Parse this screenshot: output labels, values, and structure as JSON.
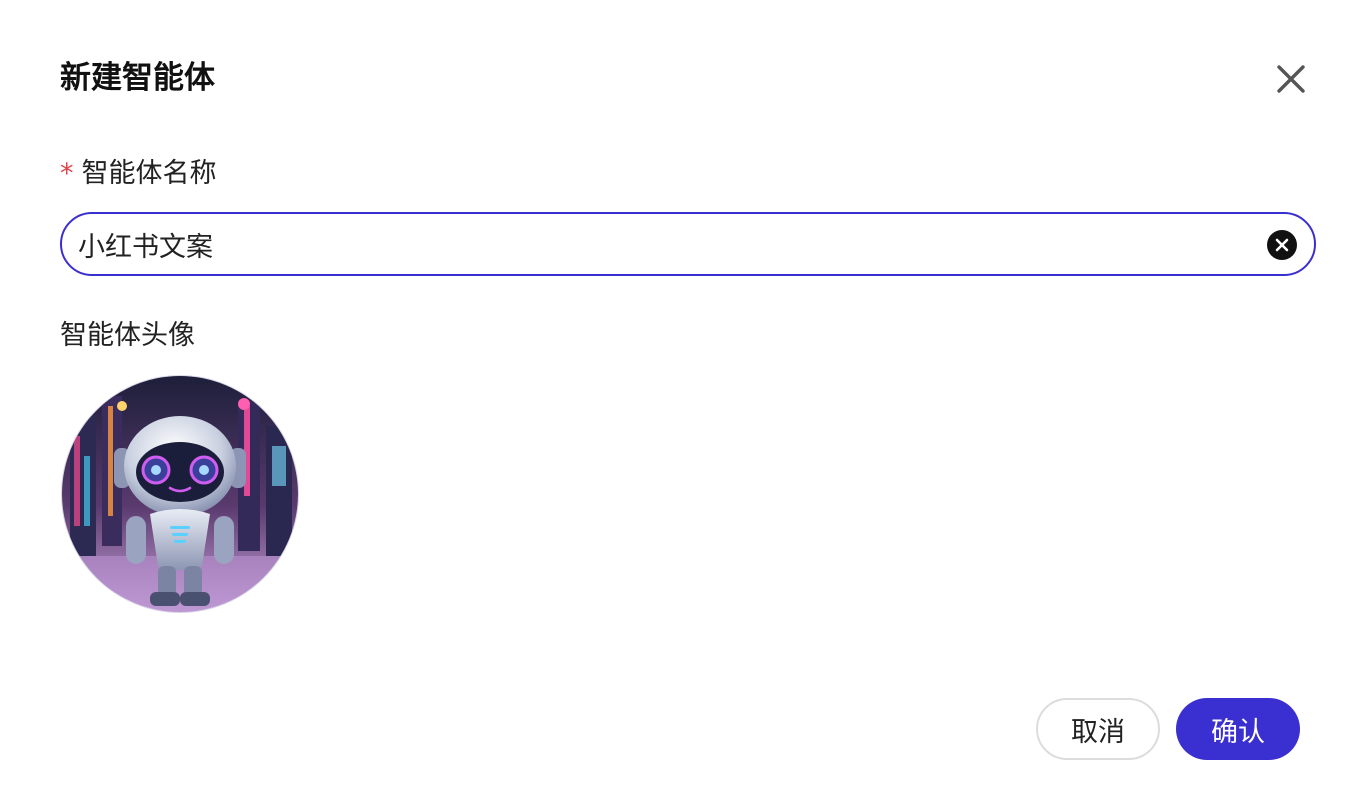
{
  "dialog": {
    "title": "新建智能体",
    "close_icon": "close-icon"
  },
  "name_field": {
    "required_mark": "*",
    "label": "智能体名称",
    "value": "小红书文案",
    "clear_icon": "clear-circle-icon"
  },
  "avatar_field": {
    "label": "智能体头像",
    "image": "robot-avatar"
  },
  "footer": {
    "cancel_label": "取消",
    "confirm_label": "确认"
  },
  "colors": {
    "accent": "#3a2fd0",
    "required": "#e0454a"
  }
}
